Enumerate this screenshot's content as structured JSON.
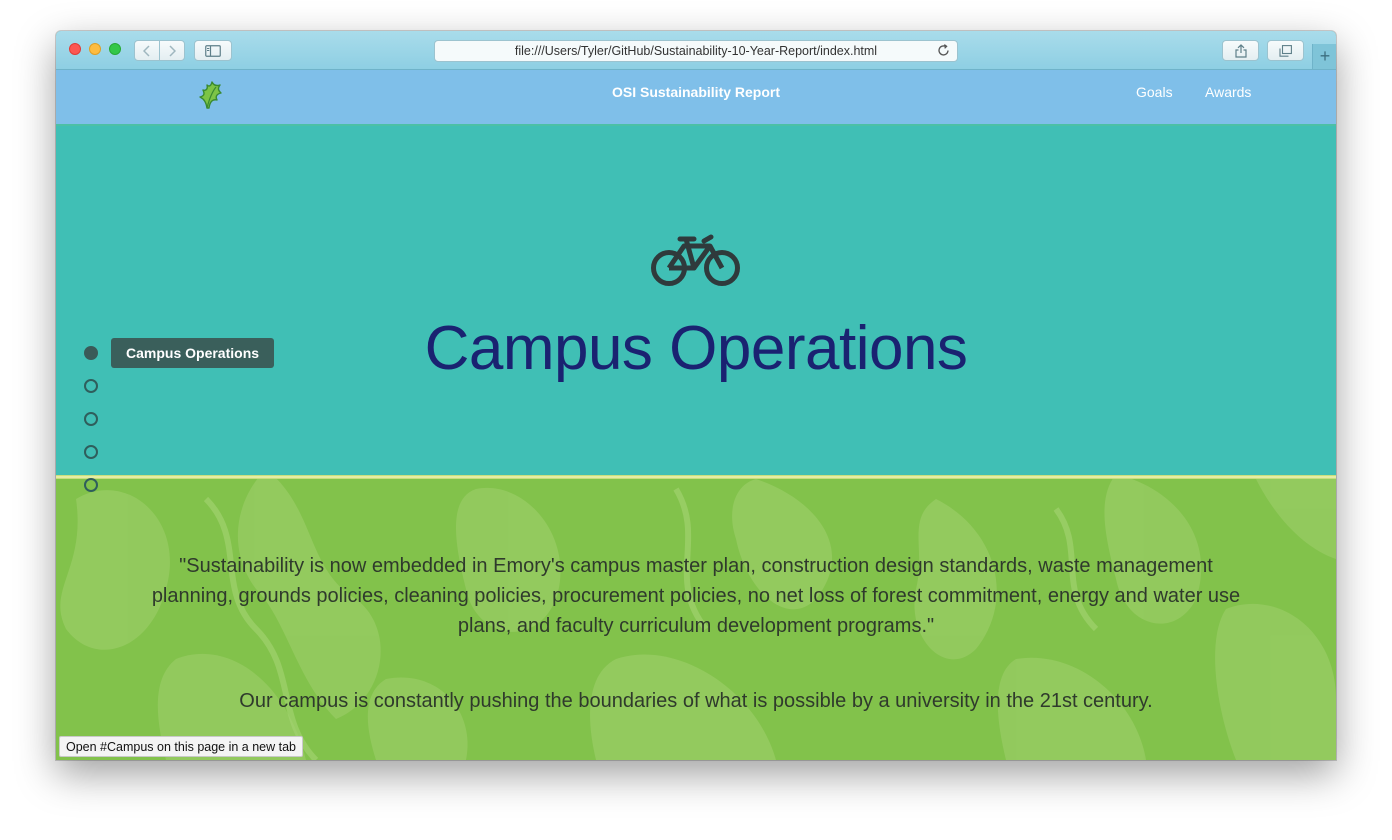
{
  "browser": {
    "url": "file:///Users/Tyler/GitHub/Sustainability-10-Year-Report/index.html",
    "status_text": "Open #Campus on this page in a new tab",
    "new_tab_symbol": "+"
  },
  "site": {
    "title": "OSI Sustainability Report",
    "logo_icon": "leaf-logo-icon",
    "nav_links": [
      "Goals",
      "Awards"
    ]
  },
  "hero": {
    "icon": "bicycle-icon",
    "title": "Campus Operations"
  },
  "side_nav": {
    "active_label": "Campus Operations",
    "dot_count": 5,
    "active_index": 0
  },
  "content": {
    "quote": "\"Sustainability is now embedded in Emory's campus master plan, construction design standards, waste management planning, grounds policies, cleaning policies, procurement policies, no net loss of forest commitment, energy and water use plans, and faculty curriculum development programs.\"",
    "statement": "Our campus is constantly pushing the boundaries of what is possible by a university in the 21st century."
  },
  "colors": {
    "hero_bg": "#40bfb5",
    "nav_bg": "#7fbfe9",
    "green_bg": "#82c24b",
    "title_color": "#1a2271",
    "tooltip_bg": "#3a5f5b"
  }
}
